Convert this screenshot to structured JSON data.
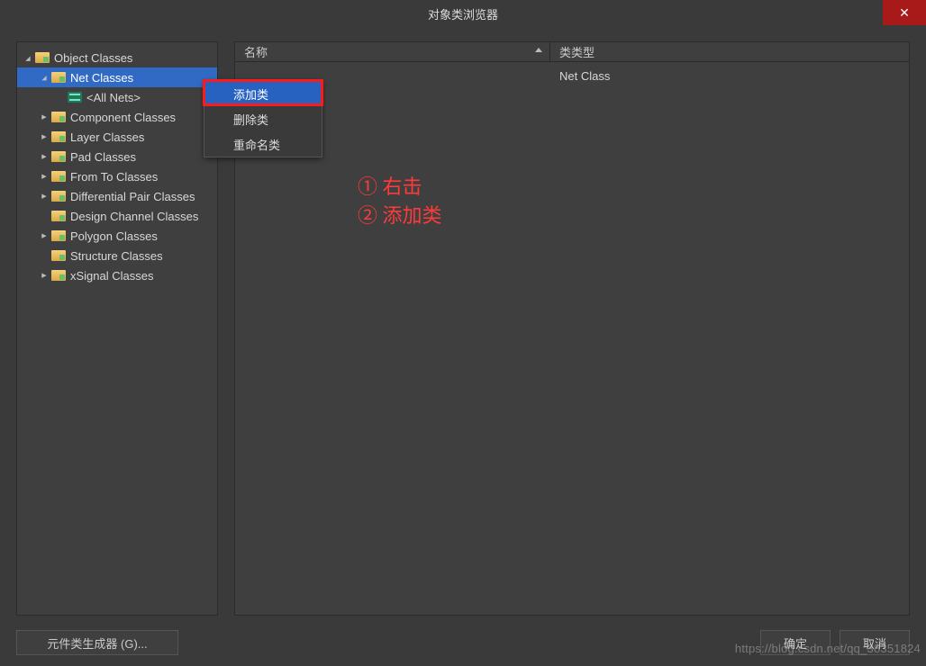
{
  "title": "对象类浏览器",
  "close_glyph": "✕",
  "tree": {
    "root": "Object Classes",
    "net_classes": "Net Classes",
    "all_nets": "<All Nets>",
    "component": "Component Classes",
    "layer": "Layer Classes",
    "pad": "Pad Classes",
    "from_to": "From To Classes",
    "diff_pair": "Differential Pair Classes",
    "design_channel": "Design Channel Classes",
    "polygon": "Polygon Classes",
    "structure": "Structure Classes",
    "xsignal": "xSignal Classes"
  },
  "columns": {
    "name": "名称",
    "type": "类类型"
  },
  "rows": [
    {
      "name": "",
      "type": "Net Class"
    }
  ],
  "context_menu": {
    "add": "添加类",
    "delete": "删除类",
    "rename": "重命名类"
  },
  "annotations": {
    "line1": "①  右击",
    "line2": "②  添加类"
  },
  "footer": {
    "generator": "元件类生成器 (G)...",
    "ok": "确定",
    "cancel": "取消"
  },
  "watermark": "https://blog.csdn.net/qq_38351824"
}
